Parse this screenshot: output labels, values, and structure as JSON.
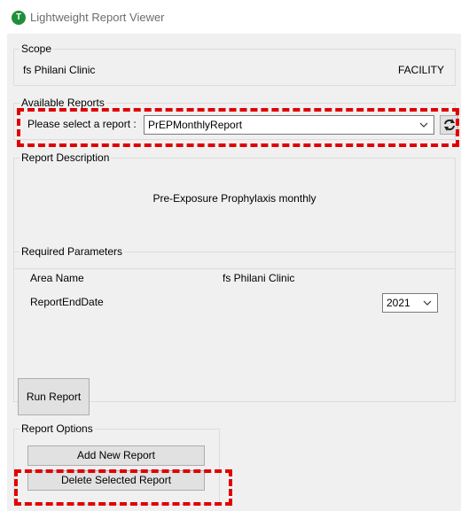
{
  "window": {
    "title": "Lightweight Report Viewer",
    "icon_letter": "T"
  },
  "scope": {
    "legend": "Scope",
    "clinic": "fs Philani Clinic",
    "level": "FACILITY"
  },
  "available_reports": {
    "legend": "Available Reports",
    "select_label": "Please select a report :",
    "selected_report": "PrEPMonthlyReport"
  },
  "report_description": {
    "legend": "Report Description",
    "text": "Pre-Exposure Prophylaxis monthly"
  },
  "required_parameters": {
    "legend": "Required Parameters",
    "area_name_label": "Area Name",
    "area_name_value": "fs Philani Clinic",
    "report_end_date_label": "ReportEndDate",
    "report_end_date_value": "2021"
  },
  "actions": {
    "run_report": "Run Report"
  },
  "report_options": {
    "legend": "Report Options",
    "add_new": "Add New Report",
    "delete_selected": "Delete Selected Report"
  }
}
